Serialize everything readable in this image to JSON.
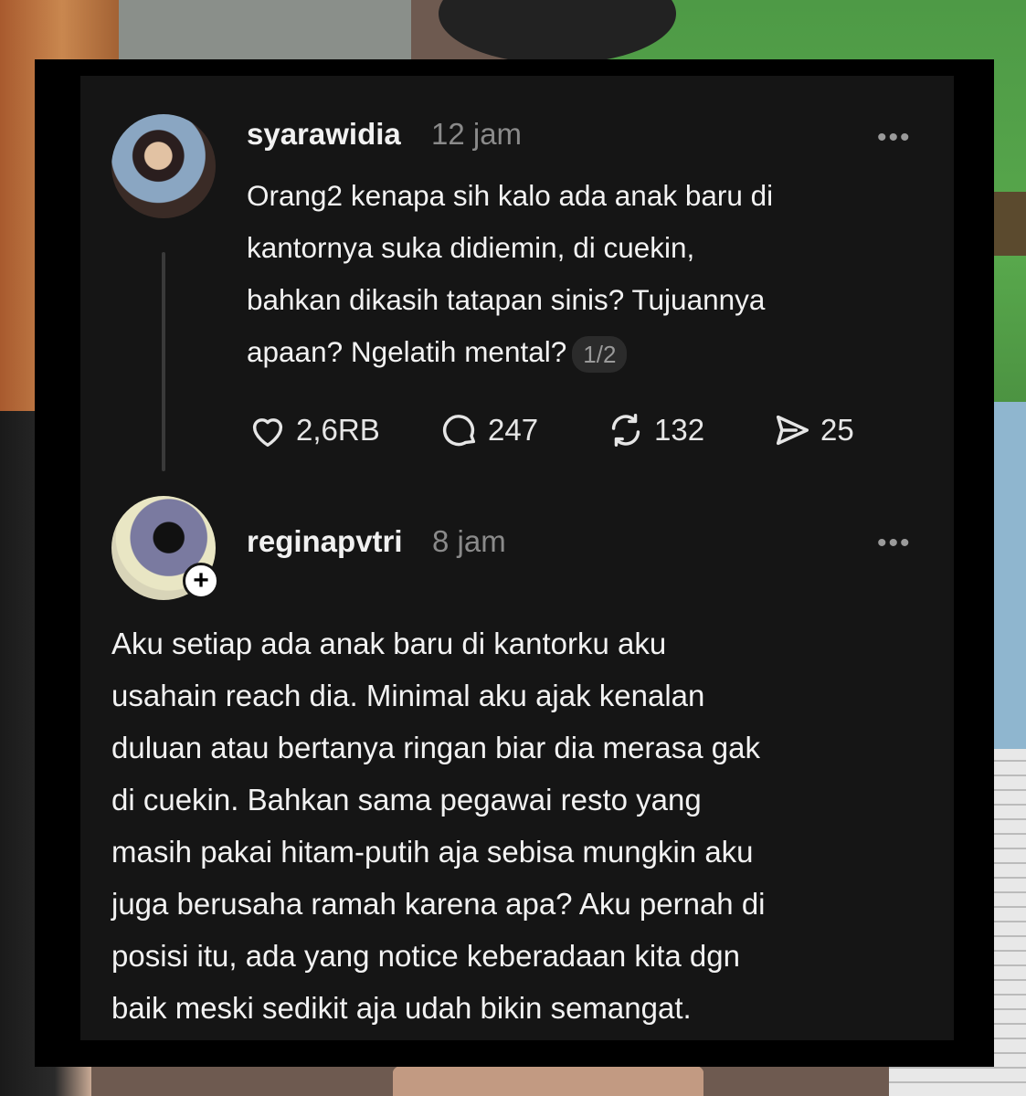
{
  "post1": {
    "username": "syarawidia",
    "time": "12 jam",
    "more": "•••",
    "lines": [
      "Orang2 kenapa sih kalo ada anak baru di",
      "kantornya suka didiemin, di cuekin,",
      "bahkan dikasih tatapan sinis? Tujuannya",
      "apaan? Ngelatih mental?"
    ],
    "pager": "1/2",
    "likes": "2,6RB",
    "replies": "247",
    "reposts": "132",
    "shares": "25"
  },
  "post2": {
    "username": "reginapvtri",
    "time": "8 jam",
    "more": "•••",
    "follow": "+",
    "lines": [
      "Aku setiap ada anak baru di kantorku aku",
      "usahain reach dia. Minimal aku ajak kenalan",
      "duluan atau bertanya ringan biar dia merasa gak",
      "di cuekin. Bahkan sama pegawai resto yang",
      "masih pakai hitam-putih aja sebisa mungkin aku",
      "juga berusaha ramah karena apa? Aku pernah di",
      "posisi itu, ada yang notice keberadaan kita dgn",
      "baik meski sedikit aja udah bikin semangat."
    ]
  },
  "icons": {
    "like": "heart-icon",
    "reply": "comment-icon",
    "repost": "repost-icon",
    "share": "send-icon"
  }
}
